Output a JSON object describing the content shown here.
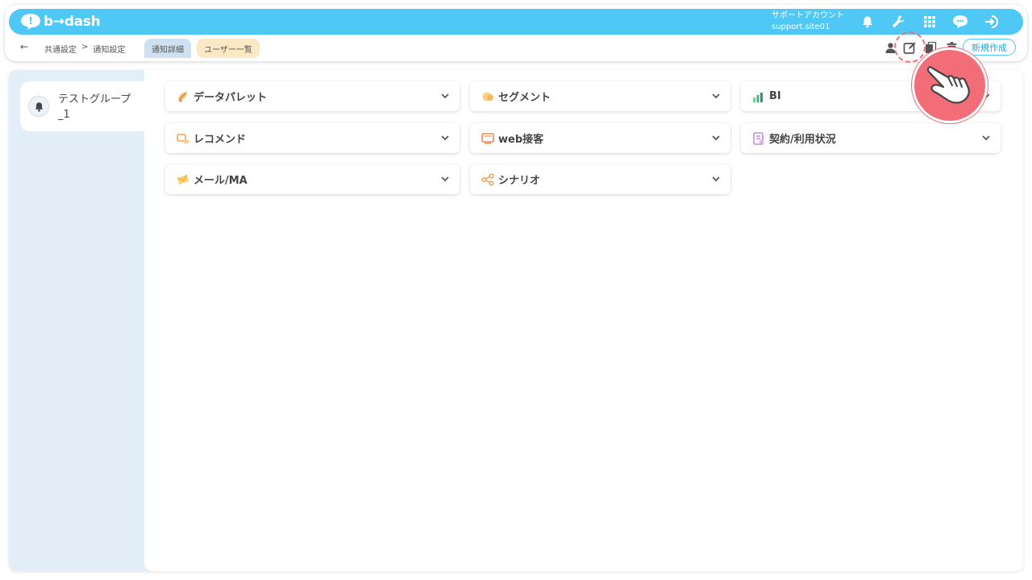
{
  "app": {
    "logo_text": "b→dash"
  },
  "account": {
    "line1": "サポートアカウント",
    "line2": "support.site01"
  },
  "topbar_icons": [
    "bell-icon",
    "wrench-icon",
    "grid-icon",
    "chat-icon",
    "logout-icon"
  ],
  "breadcrumb": {
    "back": "←",
    "parent": "共通設定",
    "separator": ">",
    "current": "通知設定"
  },
  "tabs": [
    {
      "label": "通知詳細",
      "active": true
    },
    {
      "label": "ユーザー一覧",
      "active": false
    }
  ],
  "actions": {
    "icons": [
      "user-icon",
      "edit-icon",
      "copy-icon",
      "trash-icon"
    ],
    "new_button": "新規作成"
  },
  "sidebar": {
    "groups": [
      {
        "label": "テストグループ_1",
        "icon": "bell-icon"
      }
    ]
  },
  "categories": [
    {
      "label": "データパレット",
      "icon": "palette-icon",
      "color": "#f0a64a"
    },
    {
      "label": "セグメント",
      "icon": "segment-icon",
      "color": "#f2b34e"
    },
    {
      "label": "BI",
      "icon": "chart-icon",
      "color": "#4cb07a"
    },
    {
      "label": "レコメンド",
      "icon": "recommend-icon",
      "color": "#f3a64e"
    },
    {
      "label": "web接客",
      "icon": "web-icon",
      "color": "#ef8a5a"
    },
    {
      "label": "契約/利用状況",
      "icon": "contract-icon",
      "color": "#c58bd6"
    },
    {
      "label": "メール/MA",
      "icon": "mail-icon",
      "color": "#f2b93f"
    },
    {
      "label": "シナリオ",
      "icon": "scenario-icon",
      "color": "#f39a4e"
    }
  ],
  "colors": {
    "accent": "#4fc8f5",
    "pointer": "#f36d78",
    "sidebar_bg": "#e4eef8"
  }
}
